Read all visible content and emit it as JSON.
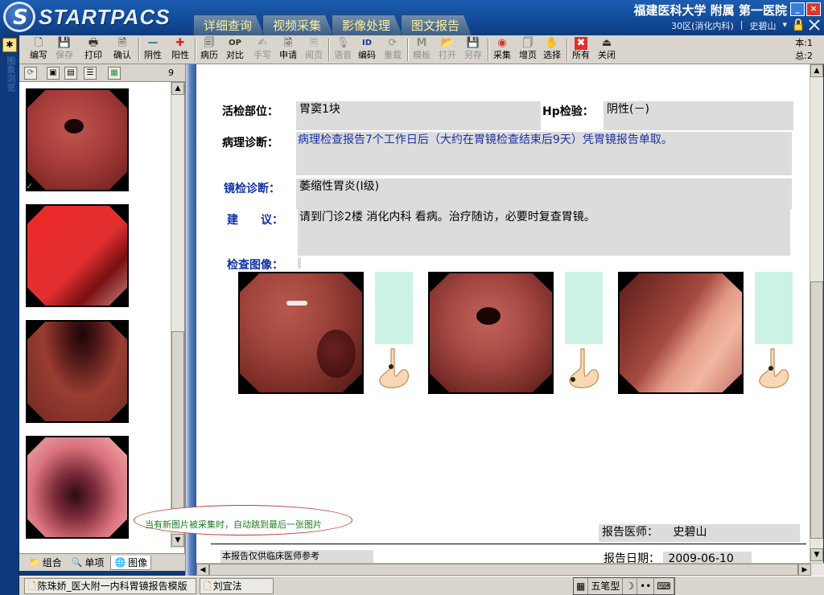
{
  "app": {
    "logo_letter": "S",
    "logo_text": "STARTPACS",
    "hospital": "福建医科大学 附属 第一医院",
    "ward": "30区(消化内科)",
    "separator": "|",
    "user": "史碧山",
    "user_dropdown": "▾",
    "min_button": "_",
    "close_button": "×"
  },
  "main_tabs": [
    "详细查询",
    "视频采集",
    "影像处理",
    "图文报告"
  ],
  "toolbar": {
    "buttons": [
      {
        "label": "编写",
        "icon": "🗋",
        "enabled": true
      },
      {
        "label": "保存",
        "icon": "💾",
        "enabled": false
      },
      {
        "label": "打印",
        "icon": "🖶",
        "enabled": true
      },
      {
        "label": "确认",
        "icon": "🗎",
        "enabled": true
      },
      {
        "label": "阴性",
        "icon": "—",
        "enabled": true
      },
      {
        "label": "阳性",
        "icon": "✚",
        "enabled": true
      },
      {
        "label": "病历",
        "icon": "🗐",
        "enabled": true
      },
      {
        "label": "对比",
        "icon": "OP",
        "enabled": true
      },
      {
        "label": "手写",
        "icon": "✍",
        "enabled": false
      },
      {
        "label": "申请",
        "icon": "🗟",
        "enabled": true
      },
      {
        "label": "阅页",
        "icon": "🗏",
        "enabled": false
      },
      {
        "label": "语音",
        "icon": "🎙",
        "enabled": false
      },
      {
        "label": "编码",
        "icon": "ID",
        "enabled": true
      },
      {
        "label": "重载",
        "icon": "⟳",
        "enabled": false
      },
      {
        "label": "模板",
        "icon": "M",
        "enabled": false
      },
      {
        "label": "打开",
        "icon": "📂",
        "enabled": false
      },
      {
        "label": "另存",
        "icon": "💾",
        "enabled": false
      },
      {
        "label": "采集",
        "icon": "◉",
        "enabled": true
      },
      {
        "label": "增页",
        "icon": "🗍",
        "enabled": true
      },
      {
        "label": "选择",
        "icon": "✋",
        "enabled": true
      },
      {
        "label": "所有",
        "icon": "✖",
        "enabled": true
      },
      {
        "label": "关闭",
        "icon": "⏏",
        "enabled": true
      }
    ],
    "counter": {
      "this_label": "本:1",
      "total_label": "总:2"
    }
  },
  "thumb_panel": {
    "count": "9",
    "tabs": [
      {
        "label": "组合",
        "icon": "📁",
        "active": false
      },
      {
        "label": "单项",
        "icon": "🔍",
        "active": false
      },
      {
        "label": "图像",
        "icon": "🌐",
        "active": true
      }
    ],
    "scroll_up": "▲",
    "scroll_down": "▼"
  },
  "annotation": {
    "text": "当有新图片被采集时，自动跳到最后一张图片"
  },
  "report": {
    "biopsy": {
      "label": "活检部位：",
      "value": "胃窦1块"
    },
    "hp": {
      "label": "Hp检验：",
      "value": "阴性(－)"
    },
    "pathology": {
      "label": "病理诊断：",
      "value": "病理检查报告7个工作日后（大约在胃镜检查结束后9天）凭胃镜报告单取。"
    },
    "endoscopy": {
      "label": "镜检诊断：",
      "value": "萎缩性胃炎(I级)"
    },
    "advice": {
      "label": "建　　议：",
      "value": "请到门诊2楼 消化内科 看病。治疗随访，必要时复查胃镜。"
    },
    "images_label": "检查图像：",
    "doctor": {
      "label": "报告医师：",
      "value": "史碧山"
    },
    "footer_note": "本报告仅供临床医师参考",
    "date": {
      "label": "报告日期：",
      "value": "2009-06-10"
    }
  },
  "taskbar": {
    "tasks": [
      "陈珠娇_医大附一内科胃镜报告模版",
      "刘宜法"
    ],
    "ime": [
      "五笔型",
      "☽",
      "••",
      "⌨"
    ]
  },
  "colors": {
    "header_blue": "#124a97",
    "tab_text": "#ffef9a",
    "label_blue": "#1131a8",
    "field_gray": "#dcdcdc",
    "mint": "#ccf2e6",
    "note_green": "#1e7d24"
  }
}
